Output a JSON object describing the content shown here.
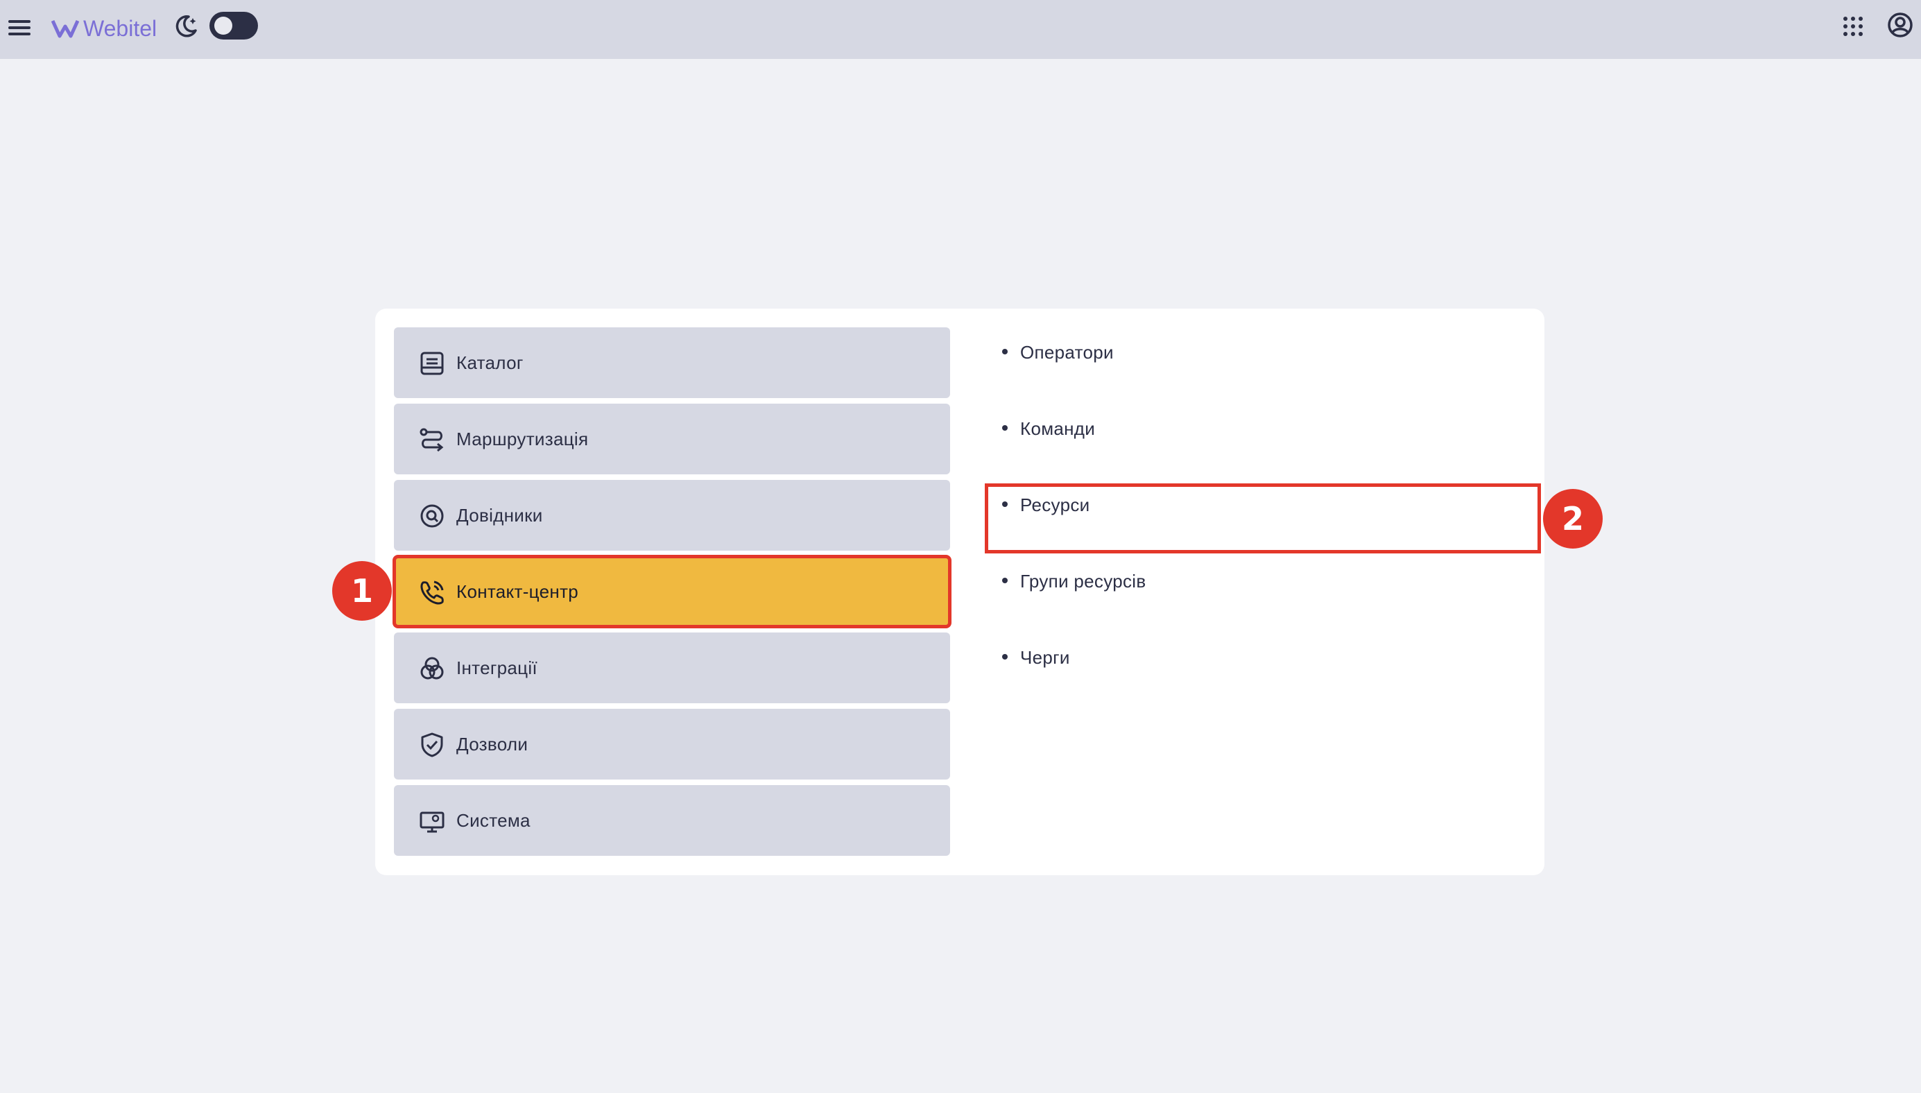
{
  "header": {
    "logo_text": "Webitel",
    "brand_color": "#7b6fd6",
    "icons": [
      "menu-icon",
      "moon-icon",
      "apps-grid-icon",
      "account-icon"
    ]
  },
  "nav": {
    "items": [
      {
        "label": "Каталог",
        "icon": "catalog-icon"
      },
      {
        "label": "Маршрутизація",
        "icon": "routing-icon"
      },
      {
        "label": "Довідники",
        "icon": "directory-search-icon"
      },
      {
        "label": "Контакт-центр",
        "icon": "phone-icon"
      },
      {
        "label": "Інтеграції",
        "icon": "integrations-icon"
      },
      {
        "label": "Дозволи",
        "icon": "shield-check-icon"
      },
      {
        "label": "Система",
        "icon": "system-monitor-icon"
      }
    ],
    "active_index": 3,
    "active_color": "#f0b940"
  },
  "submenu": {
    "items": [
      "Оператори",
      "Команди",
      "Ресурси",
      "Групи ресурсів",
      "Черги"
    ],
    "highlighted_index": 2
  },
  "annotations": {
    "badge_1": "1",
    "badge_2": "2",
    "color": "#e3372a"
  }
}
